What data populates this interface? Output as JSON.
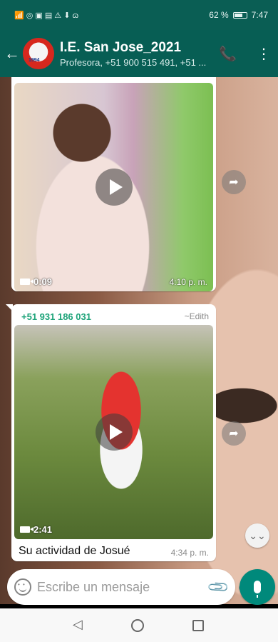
{
  "status_bar": {
    "left_icons": "📶 ◎ ▣ ▤ ⚠ ⬇ ɷ",
    "battery_percent": "62 %",
    "time": "7:47"
  },
  "header": {
    "group_name": "I.E. San Jose_2021",
    "members": "Profesora, +51 900 515 491, +51 ..."
  },
  "messages": [
    {
      "type": "video",
      "duration": "0:09",
      "time": "4:10 p. m."
    },
    {
      "type": "video",
      "sender_phone": "+51 931 186 031",
      "sender_name": "~Edith",
      "duration": "2:41",
      "caption": "Su actividad de Josué",
      "time": "4:34 p. m."
    }
  ],
  "composer": {
    "placeholder": "Escribe un mensaje"
  },
  "icons": {
    "back": "arrow-left-icon",
    "add_call": "add-call-icon",
    "menu": "more-vert-icon",
    "forward": "forward-icon",
    "scroll_down": "double-chevron-down-icon",
    "emoji": "emoji-icon",
    "attach": "paperclip-icon",
    "camera": "camera-icon",
    "mic": "mic-icon"
  },
  "colors": {
    "header": "#075e54",
    "accent": "#00897b",
    "sender_phone": "#1fa47a"
  }
}
